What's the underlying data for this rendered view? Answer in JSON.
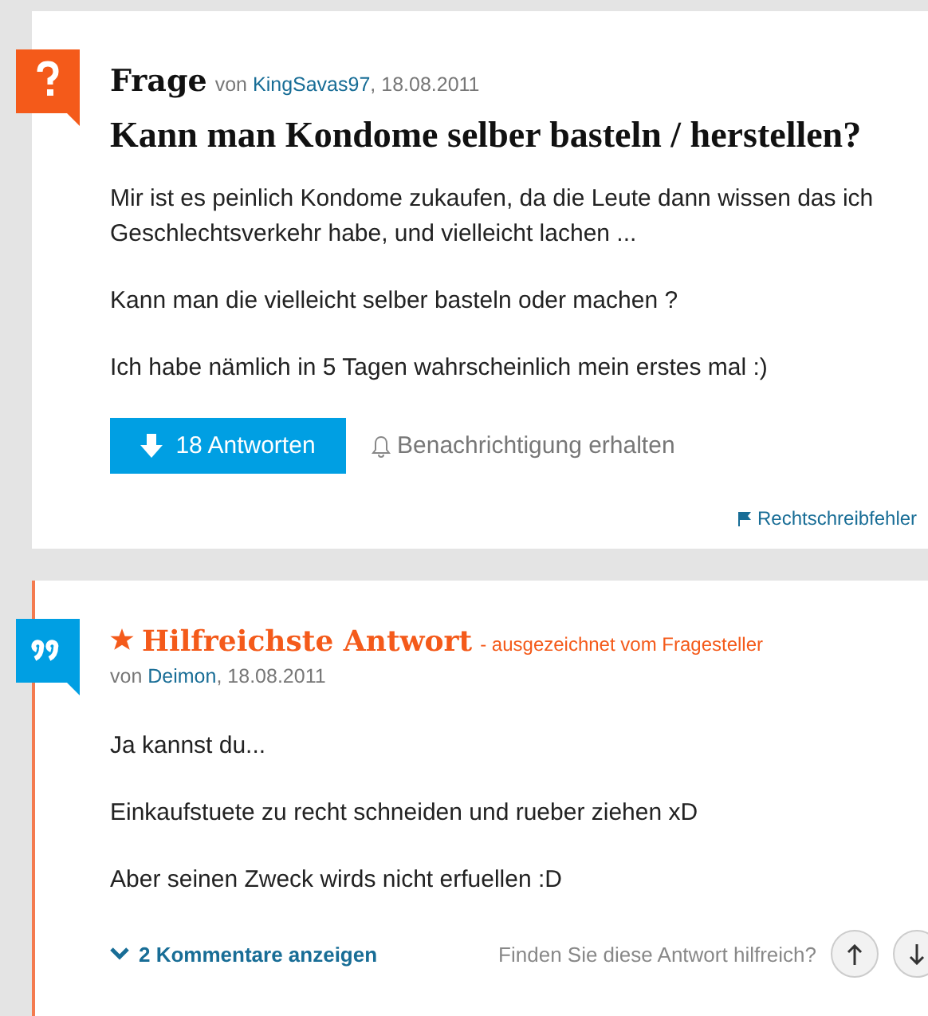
{
  "question": {
    "label": "Frage",
    "by": "von",
    "author": "KingSavas97",
    "date": ", 18.08.2011",
    "title": "Kann man Kondome selber basteln / herstellen?",
    "paragraphs": [
      "Mir ist es peinlich Kondome zukaufen, da die Leute dann wissen das ich Geschlechtsverkehr habe, und vielleicht lachen ...",
      "Kann man die vielleicht selber basteln oder machen ?",
      "Ich habe nämlich in 5 Tagen wahrscheinlich mein erstes mal :)"
    ],
    "answers_button": "18 Antworten",
    "notify": "Benachrichtigung erhalten",
    "report": "Rechtschreibfehler"
  },
  "answer": {
    "label": "Hilfreichste Antwort",
    "award": "- ausgezeichnet vom Fragesteller",
    "by": "von",
    "author": "Deimon",
    "date": ", 18.08.2011",
    "paragraphs": [
      "Ja kannst du...",
      "Einkaufstuete zu recht schneiden und rueber ziehen xD",
      "Aber seinen Zweck wirds nicht erfuellen :D"
    ],
    "comments": "2 Kommentare anzeigen",
    "helpful": "Finden Sie diese Antwort hilfreich?"
  }
}
